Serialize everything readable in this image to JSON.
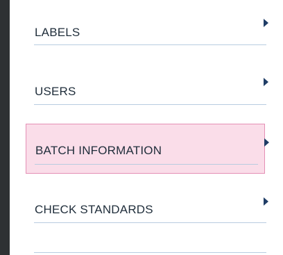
{
  "menu": {
    "items": [
      {
        "label": "LABELS",
        "selected": false,
        "icon": "chevron-right-icon"
      },
      {
        "label": "USERS",
        "selected": false,
        "icon": "chevron-right-icon"
      },
      {
        "label": "BATCH INFORMATION",
        "selected": true,
        "icon": "chevron-right-icon"
      },
      {
        "label": "CHECK STANDARDS",
        "selected": false,
        "icon": "chevron-right-icon"
      }
    ]
  },
  "colors": {
    "background": "#2e3133",
    "panel": "#ffffff",
    "text": "#1f2d3a",
    "arrow": "#1f3d66",
    "divider": "#b8cce0",
    "selected_fill": "#fadde9",
    "selected_border": "#e48fb5"
  }
}
